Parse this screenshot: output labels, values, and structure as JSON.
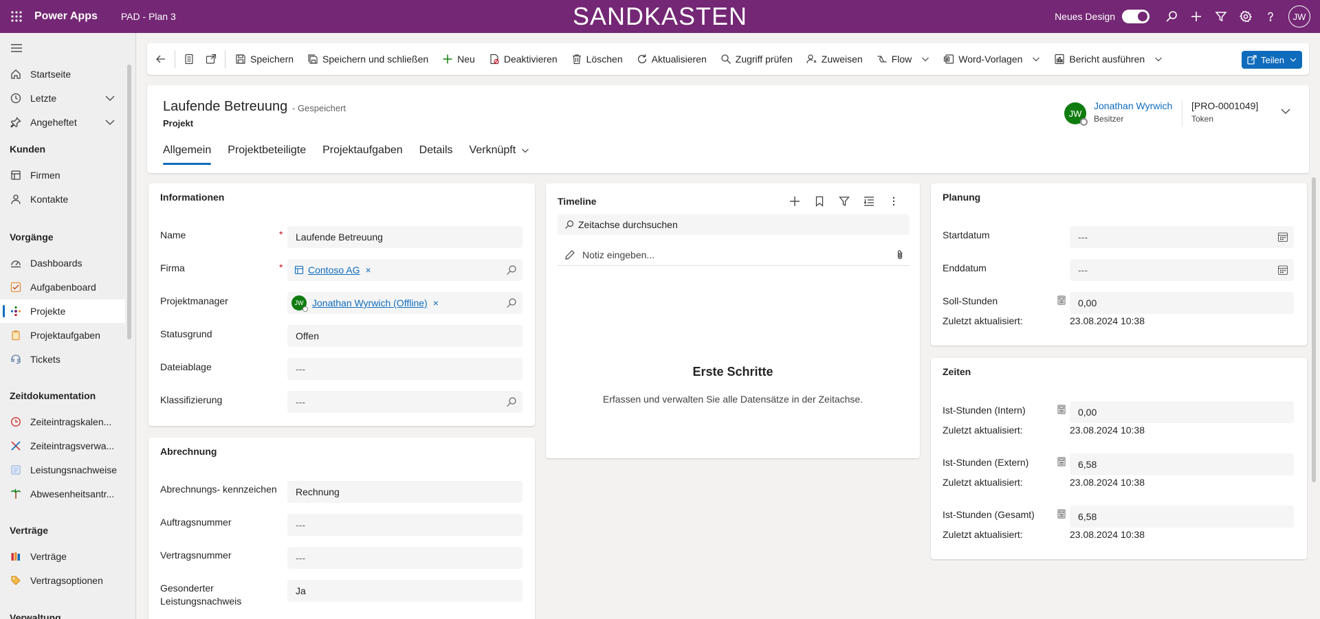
{
  "topbar": {
    "app_name": "Power Apps",
    "env_name": "PAD - Plan 3",
    "sandbox_label": "SANDKASTEN",
    "new_design_label": "Neues Design",
    "new_design_on": true,
    "user_initials": "JW",
    "icons": [
      "waffle-icon",
      "search-icon",
      "plus-icon",
      "filter-icon",
      "gear-icon",
      "help-icon"
    ]
  },
  "sidebar": {
    "items_top": [
      {
        "label": "Startseite",
        "icon": "home-icon"
      },
      {
        "label": "Letzte",
        "icon": "clock-icon",
        "expandable": true
      },
      {
        "label": "Angeheftet",
        "icon": "pin-icon",
        "expandable": true
      }
    ],
    "groups": [
      {
        "label": "Kunden",
        "items": [
          {
            "label": "Firmen",
            "icon": "building-icon"
          },
          {
            "label": "Kontakte",
            "icon": "person-icon"
          }
        ]
      },
      {
        "label": "Vorgänge",
        "items": [
          {
            "label": "Dashboards",
            "icon": "dashboard-icon"
          },
          {
            "label": "Aufgabenboard",
            "icon": "board-icon"
          },
          {
            "label": "Projekte",
            "icon": "project-icon",
            "active": true
          },
          {
            "label": "Projektaufgaben",
            "icon": "clipboard-icon"
          },
          {
            "label": "Tickets",
            "icon": "ticket-icon"
          }
        ]
      },
      {
        "label": "Zeitdokumentation",
        "items": [
          {
            "label": "Zeiteintragskalen...",
            "icon": "clock-red-icon"
          },
          {
            "label": "Zeiteintragsverwa...",
            "icon": "tools-icon"
          },
          {
            "label": "Leistungsnachweise",
            "icon": "list-icon"
          },
          {
            "label": "Abwesenheitsantr...",
            "icon": "palm-icon"
          }
        ]
      },
      {
        "label": "Verträge",
        "items": [
          {
            "label": "Verträge",
            "icon": "books-icon"
          },
          {
            "label": "Vertragsoptionen",
            "icon": "tag-icon"
          }
        ]
      },
      {
        "label": "Verwaltung",
        "items": []
      }
    ]
  },
  "commandbar": {
    "save": "Speichern",
    "save_close": "Speichern und schließen",
    "new": "Neu",
    "deactivate": "Deaktivieren",
    "delete": "Löschen",
    "refresh": "Aktualisieren",
    "check_access": "Zugriff prüfen",
    "assign": "Zuweisen",
    "flow": "Flow",
    "word_templates": "Word-Vorlagen",
    "run_report": "Bericht ausführen",
    "share": "Teilen"
  },
  "header": {
    "title": "Laufende Betreuung",
    "saved_status": "- Gespeichert",
    "entity": "Projekt",
    "owner_initials": "JW",
    "owner_name": "Jonathan Wyrwich",
    "owner_role": "Besitzer",
    "token_value": "[PRO-0001049]",
    "token_label": "Token",
    "tabs": [
      "Allgemein",
      "Projektbeteiligte",
      "Projektaufgaben",
      "Details",
      "Verknüpft"
    ]
  },
  "info": {
    "title": "Informationen",
    "name_label": "Name",
    "name_value": "Laufende Betreuung",
    "firma_label": "Firma",
    "firma_value": "Contoso AG",
    "pm_label": "Projektmanager",
    "pm_initials": "JW",
    "pm_value": "Jonathan Wyrwich (Offline)",
    "status_label": "Statusgrund",
    "status_value": "Offen",
    "storage_label": "Dateiablage",
    "storage_value": "---",
    "class_label": "Klassifizierung",
    "class_value": "---",
    "required_mark": "*",
    "remove_mark": "×"
  },
  "billing": {
    "title": "Abrechnung",
    "flag_label": "Abrechnungs- kennzeichen",
    "flag_value": "Rechnung",
    "order_label": "Auftragsnummer",
    "order_value": "---",
    "contract_label": "Vertragsnummer",
    "contract_value": "---",
    "proof_label": "Gesonderter Leistungsnachweis",
    "proof_value": "Ja"
  },
  "timeline": {
    "title": "Timeline",
    "search_placeholder": "Zeitachse durchsuchen",
    "note_placeholder": "Notiz eingeben...",
    "empty_title": "Erste Schritte",
    "empty_sub": "Erfassen und verwalten Sie alle Datensätze in der Zeitachse."
  },
  "planning": {
    "title": "Planung",
    "start_label": "Startdatum",
    "start_value": "---",
    "end_label": "Enddatum",
    "end_value": "---",
    "hours_label": "Soll-Stunden",
    "hours_value": "0,00",
    "updated_label": "Zuletzt aktualisiert:",
    "updated_value": "23.08.2024 10:38"
  },
  "times": {
    "title": "Zeiten",
    "rows": [
      {
        "label": "Ist-Stunden (Intern)",
        "value": "0,00",
        "updated_label": "Zuletzt aktualisiert:",
        "updated_value": "23.08.2024 10:38"
      },
      {
        "label": "Ist-Stunden (Extern)",
        "value": "6,58",
        "updated_label": "Zuletzt aktualisiert:",
        "updated_value": "23.08.2024 10:38"
      },
      {
        "label": "Ist-Stunden (Gesamt)",
        "value": "6,58",
        "updated_label": "Zuletzt aktualisiert:",
        "updated_value": "23.08.2024 10:38"
      }
    ]
  },
  "colors": {
    "topbar": "#742774",
    "accent": "#0f6cbd",
    "avatar": "#107c10",
    "required": "#c50f1f"
  }
}
